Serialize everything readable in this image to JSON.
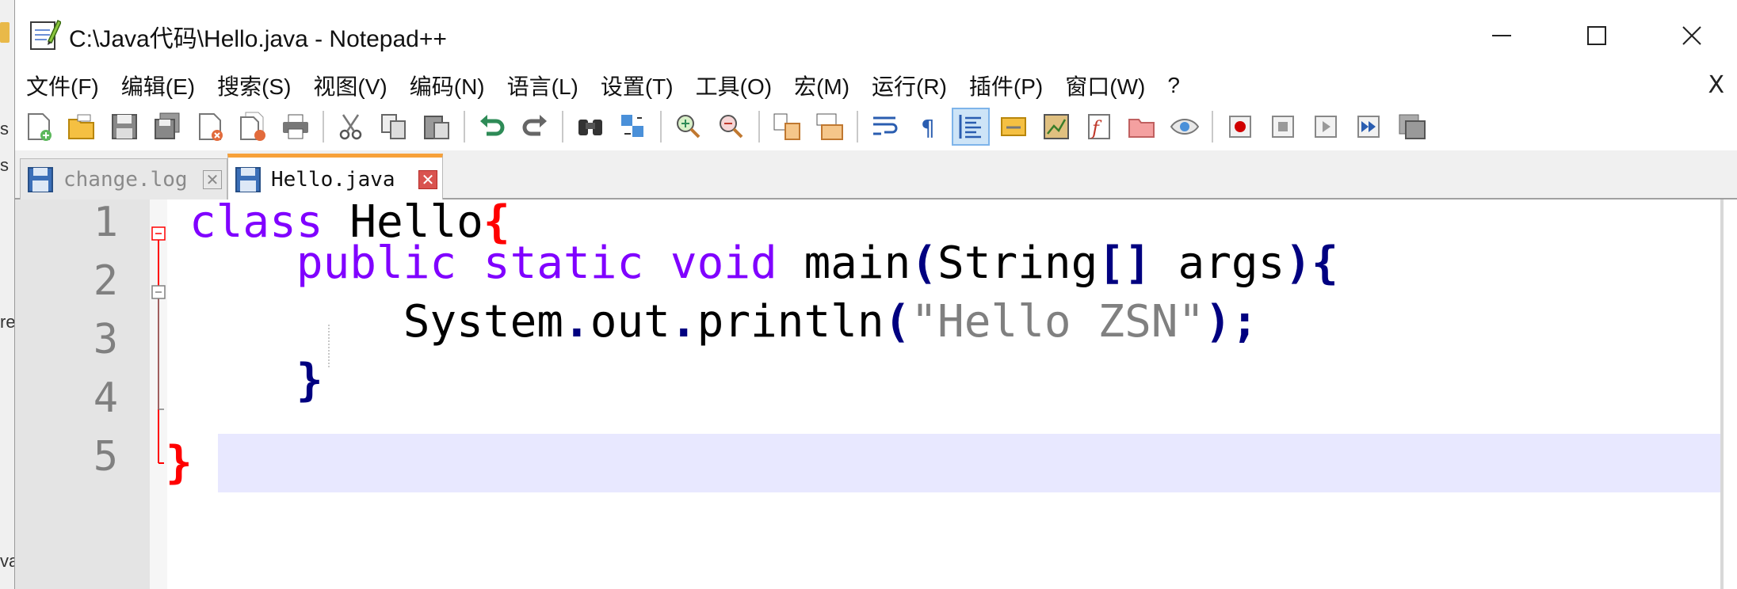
{
  "window": {
    "title": "C:\\Java代码\\Hello.java - Notepad++",
    "minimize_glyph": "—",
    "close_glyph": "✕"
  },
  "menu": {
    "items": [
      "文件(F)",
      "编辑(E)",
      "搜索(S)",
      "视图(V)",
      "编码(N)",
      "语言(L)",
      "设置(T)",
      "工具(O)",
      "宏(M)",
      "运行(R)",
      "插件(P)",
      "窗口(W)",
      "?"
    ],
    "close_label": "X"
  },
  "toolbar": {
    "icons": [
      "new-file-icon",
      "open-file-icon",
      "save-icon",
      "save-all-icon",
      "close-icon",
      "close-all-icon",
      "print-icon",
      "cut-icon",
      "copy-icon",
      "paste-icon",
      "undo-icon",
      "redo-icon",
      "find-icon",
      "replace-icon",
      "zoom-in-icon",
      "zoom-out-icon",
      "sync-vertical-icon",
      "sync-horizontal-icon",
      "word-wrap-icon",
      "show-all-chars-icon",
      "indent-guide-icon",
      "function-list-icon",
      "document-map-icon",
      "folder-workspace-icon",
      "folder-icon",
      "monitoring-icon",
      "record-macro-icon",
      "stop-macro-icon",
      "play-macro-icon",
      "run-macro-multiple-icon",
      "save-macro-icon"
    ]
  },
  "tabs": [
    {
      "label": "change.log",
      "active": false,
      "close_glyph": "✕"
    },
    {
      "label": "Hello.java",
      "active": true,
      "close_glyph": "✕"
    }
  ],
  "editor": {
    "line_numbers": [
      "1",
      "2",
      "3",
      "4",
      "5"
    ],
    "current_line": 5,
    "lines": [
      {
        "indent": "",
        "t1": "class",
        "t2": " Hello",
        "t3": "{"
      },
      {
        "indent": "    ",
        "t1": "public",
        "t2": " ",
        "t3": "static",
        "t4": " ",
        "t5": "void",
        "t6": " main",
        "t7": "(",
        "t8": "String",
        "t9": "[]",
        "t10": " args",
        "t11": "){"
      },
      {
        "indent": "        ",
        "t1": "System",
        "t2": ".",
        "t3": "out",
        "t4": ".",
        "t5": "println",
        "t6": "(",
        "t7": "\"Hello ZSN\"",
        "t8": ");"
      },
      {
        "indent": "    ",
        "t1": "}"
      },
      {
        "indent": "",
        "t1": "}"
      }
    ]
  },
  "desktop_fragments": [
    "s",
    "s",
    "re",
    "va"
  ],
  "colors": {
    "keyword": "#8000ff",
    "brace_outer": "#ff0000",
    "brace_inner": "#000080",
    "string": "#808080",
    "current_line": "#e8e8ff",
    "active_tab_accent": "#f7a13a"
  }
}
